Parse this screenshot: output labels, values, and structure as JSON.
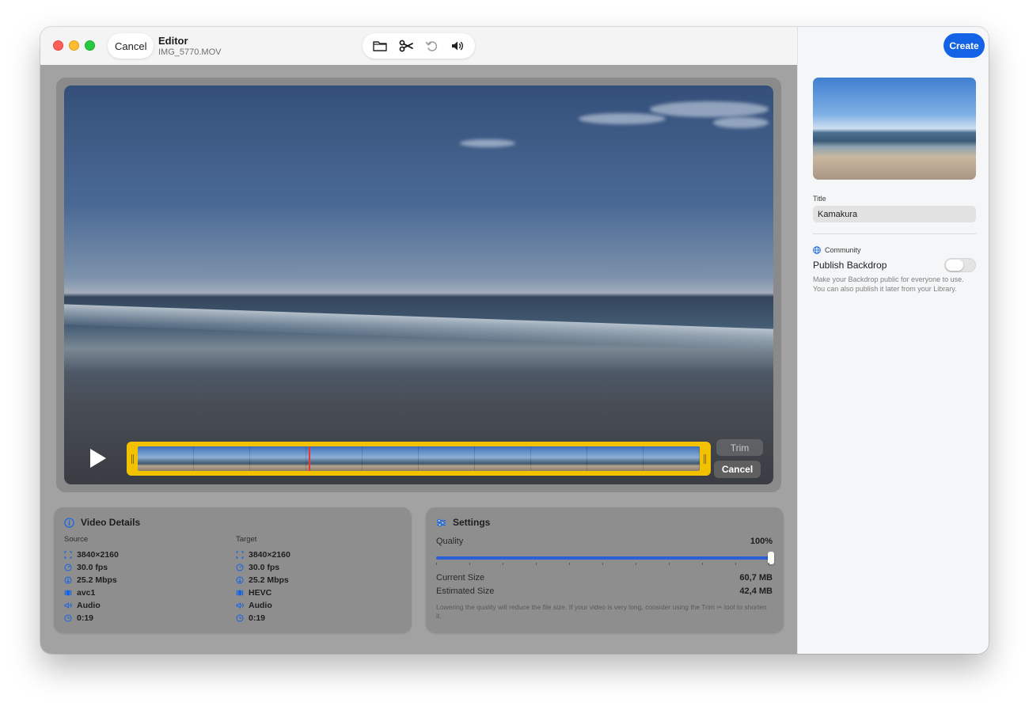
{
  "titlebar": {
    "cancel_label": "Cancel",
    "title": "Editor",
    "file_name": "IMG_5770.MOV"
  },
  "toolbar": {
    "icons": [
      "folder-icon",
      "scissors-icon",
      "rotate-icon",
      "speaker-icon"
    ]
  },
  "player": {
    "trim_label": "Trim",
    "cancel_label": "Cancel",
    "frame_count": 10
  },
  "video_details": {
    "heading": "Video Details",
    "source_label": "Source",
    "target_label": "Target",
    "source": [
      {
        "icon": "resolution-icon",
        "value": "3840×2160"
      },
      {
        "icon": "framerate-icon",
        "value": "30.0 fps"
      },
      {
        "icon": "bitrate-icon",
        "value": "25.2 Mbps"
      },
      {
        "icon": "codec-icon",
        "value": "avc1"
      },
      {
        "icon": "audio-icon",
        "value": "Audio"
      },
      {
        "icon": "duration-icon",
        "value": "0:19"
      }
    ],
    "target": [
      {
        "icon": "resolution-icon",
        "value": "3840×2160"
      },
      {
        "icon": "framerate-icon",
        "value": "30.0 fps"
      },
      {
        "icon": "bitrate-icon",
        "value": "25.2 Mbps"
      },
      {
        "icon": "codec-icon",
        "value": "HEVC"
      },
      {
        "icon": "audio-icon",
        "value": "Audio"
      },
      {
        "icon": "duration-icon",
        "value": "0:19"
      }
    ]
  },
  "settings": {
    "heading": "Settings",
    "quality_label": "Quality",
    "quality_value": "100%",
    "quality_level": 1.0,
    "current_size_label": "Current Size",
    "current_size_value": "60,7 MB",
    "estimated_size_label": "Estimated Size",
    "estimated_size_value": "42,4 MB",
    "note": "Lowering the quality will reduce the file size. If your video is very long, consider using the Trim ✂ tool to shorten it."
  },
  "sidebar": {
    "create_label": "Create",
    "title_label": "Title",
    "title_value": "Kamakura",
    "community_label": "Community",
    "publish_label": "Publish Backdrop",
    "publish_on": false,
    "publish_desc": "Make your Backdrop public for everyone to use. You can also publish it later from your Library."
  },
  "colors": {
    "accent": "#1463e6",
    "trim_border": "#f2c200",
    "playhead": "#e53935"
  }
}
